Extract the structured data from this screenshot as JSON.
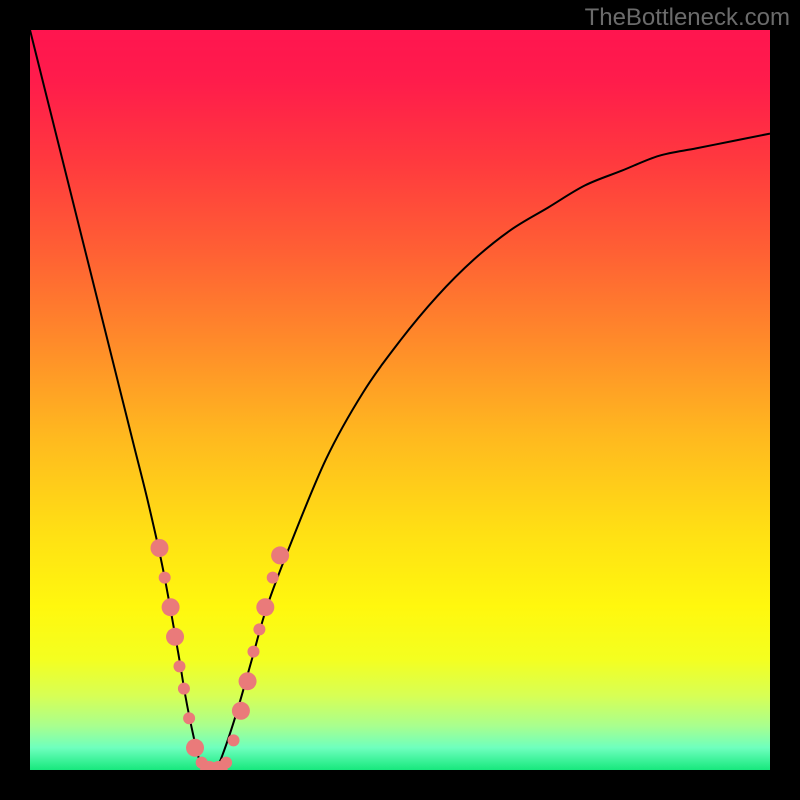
{
  "watermark": "TheBottleneck.com",
  "chart_data": {
    "type": "line",
    "title": "",
    "xlabel": "",
    "ylabel": "",
    "xlim": [
      0,
      100
    ],
    "ylim": [
      0,
      100
    ],
    "grid": false,
    "legend": null,
    "background_gradient": {
      "stops": [
        {
          "pos": 0.0,
          "color": "#ff154f"
        },
        {
          "pos": 0.07,
          "color": "#ff1c4b"
        },
        {
          "pos": 0.18,
          "color": "#ff3a3e"
        },
        {
          "pos": 0.3,
          "color": "#ff6034"
        },
        {
          "pos": 0.42,
          "color": "#ff8a2a"
        },
        {
          "pos": 0.55,
          "color": "#ffb91f"
        },
        {
          "pos": 0.68,
          "color": "#ffe014"
        },
        {
          "pos": 0.78,
          "color": "#fff80e"
        },
        {
          "pos": 0.85,
          "color": "#f4ff20"
        },
        {
          "pos": 0.9,
          "color": "#d7ff55"
        },
        {
          "pos": 0.94,
          "color": "#a9ff8e"
        },
        {
          "pos": 0.97,
          "color": "#6effbe"
        },
        {
          "pos": 1.0,
          "color": "#17e87d"
        }
      ]
    },
    "series": [
      {
        "name": "bottleneck-curve",
        "color": "#000000",
        "stroke_width": 2,
        "x": [
          0,
          2,
          4,
          6,
          8,
          10,
          12,
          14,
          16,
          18,
          20,
          21,
          22,
          23,
          24,
          25,
          26,
          28,
          30,
          32,
          35,
          40,
          45,
          50,
          55,
          60,
          65,
          70,
          75,
          80,
          85,
          90,
          95,
          100
        ],
        "values": [
          100,
          92,
          84,
          76,
          68,
          60,
          52,
          44,
          36,
          27,
          16,
          10,
          5,
          1,
          0,
          0,
          2,
          8,
          15,
          22,
          30,
          42,
          51,
          58,
          64,
          69,
          73,
          76,
          79,
          81,
          83,
          84,
          85,
          86
        ]
      }
    ],
    "markers": {
      "name": "highlight-points",
      "color": "#ea7a7a",
      "radius_small": 6,
      "radius_large": 9,
      "points": [
        {
          "x": 17.5,
          "y": 30,
          "r": "large"
        },
        {
          "x": 18.2,
          "y": 26,
          "r": "small"
        },
        {
          "x": 19.0,
          "y": 22,
          "r": "large"
        },
        {
          "x": 19.6,
          "y": 18,
          "r": "large"
        },
        {
          "x": 20.2,
          "y": 14,
          "r": "small"
        },
        {
          "x": 20.8,
          "y": 11,
          "r": "small"
        },
        {
          "x": 21.5,
          "y": 7,
          "r": "small"
        },
        {
          "x": 22.3,
          "y": 3,
          "r": "large"
        },
        {
          "x": 23.2,
          "y": 1,
          "r": "small"
        },
        {
          "x": 24.2,
          "y": 0,
          "r": "large"
        },
        {
          "x": 25.5,
          "y": 0,
          "r": "large"
        },
        {
          "x": 26.5,
          "y": 1,
          "r": "small"
        },
        {
          "x": 27.5,
          "y": 4,
          "r": "small"
        },
        {
          "x": 28.5,
          "y": 8,
          "r": "large"
        },
        {
          "x": 29.4,
          "y": 12,
          "r": "large"
        },
        {
          "x": 30.2,
          "y": 16,
          "r": "small"
        },
        {
          "x": 31.0,
          "y": 19,
          "r": "small"
        },
        {
          "x": 31.8,
          "y": 22,
          "r": "large"
        },
        {
          "x": 32.8,
          "y": 26,
          "r": "small"
        },
        {
          "x": 33.8,
          "y": 29,
          "r": "large"
        }
      ]
    }
  }
}
